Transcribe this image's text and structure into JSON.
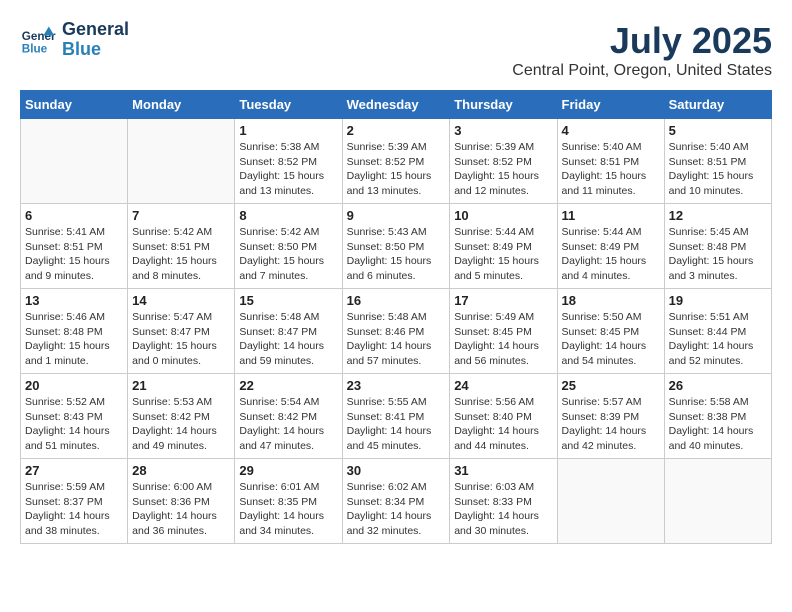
{
  "header": {
    "logo_line1": "General",
    "logo_line2": "Blue",
    "month_year": "July 2025",
    "location": "Central Point, Oregon, United States"
  },
  "days_of_week": [
    "Sunday",
    "Monday",
    "Tuesday",
    "Wednesday",
    "Thursday",
    "Friday",
    "Saturday"
  ],
  "weeks": [
    [
      {
        "day": "",
        "sunrise": "",
        "sunset": "",
        "daylight": ""
      },
      {
        "day": "",
        "sunrise": "",
        "sunset": "",
        "daylight": ""
      },
      {
        "day": "1",
        "sunrise": "Sunrise: 5:38 AM",
        "sunset": "Sunset: 8:52 PM",
        "daylight": "Daylight: 15 hours and 13 minutes."
      },
      {
        "day": "2",
        "sunrise": "Sunrise: 5:39 AM",
        "sunset": "Sunset: 8:52 PM",
        "daylight": "Daylight: 15 hours and 13 minutes."
      },
      {
        "day": "3",
        "sunrise": "Sunrise: 5:39 AM",
        "sunset": "Sunset: 8:52 PM",
        "daylight": "Daylight: 15 hours and 12 minutes."
      },
      {
        "day": "4",
        "sunrise": "Sunrise: 5:40 AM",
        "sunset": "Sunset: 8:51 PM",
        "daylight": "Daylight: 15 hours and 11 minutes."
      },
      {
        "day": "5",
        "sunrise": "Sunrise: 5:40 AM",
        "sunset": "Sunset: 8:51 PM",
        "daylight": "Daylight: 15 hours and 10 minutes."
      }
    ],
    [
      {
        "day": "6",
        "sunrise": "Sunrise: 5:41 AM",
        "sunset": "Sunset: 8:51 PM",
        "daylight": "Daylight: 15 hours and 9 minutes."
      },
      {
        "day": "7",
        "sunrise": "Sunrise: 5:42 AM",
        "sunset": "Sunset: 8:51 PM",
        "daylight": "Daylight: 15 hours and 8 minutes."
      },
      {
        "day": "8",
        "sunrise": "Sunrise: 5:42 AM",
        "sunset": "Sunset: 8:50 PM",
        "daylight": "Daylight: 15 hours and 7 minutes."
      },
      {
        "day": "9",
        "sunrise": "Sunrise: 5:43 AM",
        "sunset": "Sunset: 8:50 PM",
        "daylight": "Daylight: 15 hours and 6 minutes."
      },
      {
        "day": "10",
        "sunrise": "Sunrise: 5:44 AM",
        "sunset": "Sunset: 8:49 PM",
        "daylight": "Daylight: 15 hours and 5 minutes."
      },
      {
        "day": "11",
        "sunrise": "Sunrise: 5:44 AM",
        "sunset": "Sunset: 8:49 PM",
        "daylight": "Daylight: 15 hours and 4 minutes."
      },
      {
        "day": "12",
        "sunrise": "Sunrise: 5:45 AM",
        "sunset": "Sunset: 8:48 PM",
        "daylight": "Daylight: 15 hours and 3 minutes."
      }
    ],
    [
      {
        "day": "13",
        "sunrise": "Sunrise: 5:46 AM",
        "sunset": "Sunset: 8:48 PM",
        "daylight": "Daylight: 15 hours and 1 minute."
      },
      {
        "day": "14",
        "sunrise": "Sunrise: 5:47 AM",
        "sunset": "Sunset: 8:47 PM",
        "daylight": "Daylight: 15 hours and 0 minutes."
      },
      {
        "day": "15",
        "sunrise": "Sunrise: 5:48 AM",
        "sunset": "Sunset: 8:47 PM",
        "daylight": "Daylight: 14 hours and 59 minutes."
      },
      {
        "day": "16",
        "sunrise": "Sunrise: 5:48 AM",
        "sunset": "Sunset: 8:46 PM",
        "daylight": "Daylight: 14 hours and 57 minutes."
      },
      {
        "day": "17",
        "sunrise": "Sunrise: 5:49 AM",
        "sunset": "Sunset: 8:45 PM",
        "daylight": "Daylight: 14 hours and 56 minutes."
      },
      {
        "day": "18",
        "sunrise": "Sunrise: 5:50 AM",
        "sunset": "Sunset: 8:45 PM",
        "daylight": "Daylight: 14 hours and 54 minutes."
      },
      {
        "day": "19",
        "sunrise": "Sunrise: 5:51 AM",
        "sunset": "Sunset: 8:44 PM",
        "daylight": "Daylight: 14 hours and 52 minutes."
      }
    ],
    [
      {
        "day": "20",
        "sunrise": "Sunrise: 5:52 AM",
        "sunset": "Sunset: 8:43 PM",
        "daylight": "Daylight: 14 hours and 51 minutes."
      },
      {
        "day": "21",
        "sunrise": "Sunrise: 5:53 AM",
        "sunset": "Sunset: 8:42 PM",
        "daylight": "Daylight: 14 hours and 49 minutes."
      },
      {
        "day": "22",
        "sunrise": "Sunrise: 5:54 AM",
        "sunset": "Sunset: 8:42 PM",
        "daylight": "Daylight: 14 hours and 47 minutes."
      },
      {
        "day": "23",
        "sunrise": "Sunrise: 5:55 AM",
        "sunset": "Sunset: 8:41 PM",
        "daylight": "Daylight: 14 hours and 45 minutes."
      },
      {
        "day": "24",
        "sunrise": "Sunrise: 5:56 AM",
        "sunset": "Sunset: 8:40 PM",
        "daylight": "Daylight: 14 hours and 44 minutes."
      },
      {
        "day": "25",
        "sunrise": "Sunrise: 5:57 AM",
        "sunset": "Sunset: 8:39 PM",
        "daylight": "Daylight: 14 hours and 42 minutes."
      },
      {
        "day": "26",
        "sunrise": "Sunrise: 5:58 AM",
        "sunset": "Sunset: 8:38 PM",
        "daylight": "Daylight: 14 hours and 40 minutes."
      }
    ],
    [
      {
        "day": "27",
        "sunrise": "Sunrise: 5:59 AM",
        "sunset": "Sunset: 8:37 PM",
        "daylight": "Daylight: 14 hours and 38 minutes."
      },
      {
        "day": "28",
        "sunrise": "Sunrise: 6:00 AM",
        "sunset": "Sunset: 8:36 PM",
        "daylight": "Daylight: 14 hours and 36 minutes."
      },
      {
        "day": "29",
        "sunrise": "Sunrise: 6:01 AM",
        "sunset": "Sunset: 8:35 PM",
        "daylight": "Daylight: 14 hours and 34 minutes."
      },
      {
        "day": "30",
        "sunrise": "Sunrise: 6:02 AM",
        "sunset": "Sunset: 8:34 PM",
        "daylight": "Daylight: 14 hours and 32 minutes."
      },
      {
        "day": "31",
        "sunrise": "Sunrise: 6:03 AM",
        "sunset": "Sunset: 8:33 PM",
        "daylight": "Daylight: 14 hours and 30 minutes."
      },
      {
        "day": "",
        "sunrise": "",
        "sunset": "",
        "daylight": ""
      },
      {
        "day": "",
        "sunrise": "",
        "sunset": "",
        "daylight": ""
      }
    ]
  ]
}
